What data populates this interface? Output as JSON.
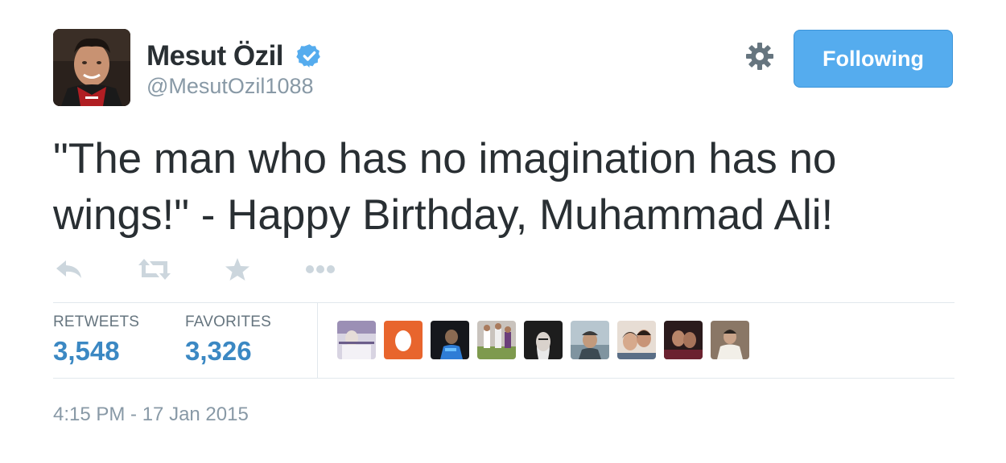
{
  "author": {
    "name": "Mesut Özil",
    "handle": "@MesutOzil1088",
    "verified": true
  },
  "follow_button_label": "Following",
  "tweet": {
    "text_line1": "\"The man who has no imagination has no",
    "text_line2": "wings!\" - Happy Birthday, Muhammad Ali!"
  },
  "actions": [
    {
      "name": "reply",
      "icon": "reply-icon"
    },
    {
      "name": "retweet",
      "icon": "retweet-icon"
    },
    {
      "name": "favorite",
      "icon": "star-icon"
    },
    {
      "name": "more",
      "icon": "more-dots-icon"
    }
  ],
  "stats": {
    "retweets_label": "RETWEETS",
    "retweets_value": "3,548",
    "favorites_label": "FAVORITES",
    "favorites_value": "3,326"
  },
  "favoriter_avatars_count": 9,
  "timestamp": "4:15 PM - 17 Jan 2015",
  "colors": {
    "accent": "#55acee",
    "stat_value": "#3b88c3",
    "muted_text": "#8899a6",
    "icon_gray": "#ccd6dd",
    "divider": "#e1e8ed"
  }
}
